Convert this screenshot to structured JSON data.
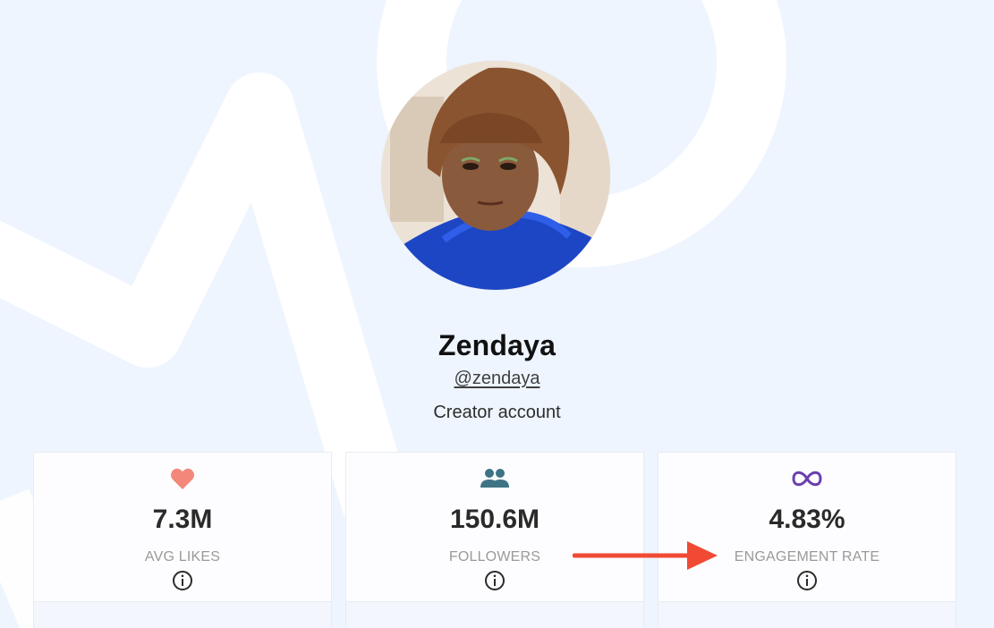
{
  "profile": {
    "name": "Zendaya",
    "handle": "@zendaya",
    "account_type": "Creator account",
    "avatar_alt": "profile photo"
  },
  "stats": [
    {
      "icon": "heart-icon",
      "icon_color": "#f2877a",
      "value": "7.3M",
      "label": "AVG LIKES"
    },
    {
      "icon": "users-icon",
      "icon_color": "#3d7384",
      "value": "150.6M",
      "label": "FOLLOWERS"
    },
    {
      "icon": "infinity-icon",
      "icon_color": "#6a3fb0",
      "value": "4.83%",
      "label": "ENGAGEMENT RATE"
    }
  ],
  "colors": {
    "background": "#eef5fe",
    "annotation_arrow": "#f04a35",
    "card_background": "#fdfdff"
  }
}
